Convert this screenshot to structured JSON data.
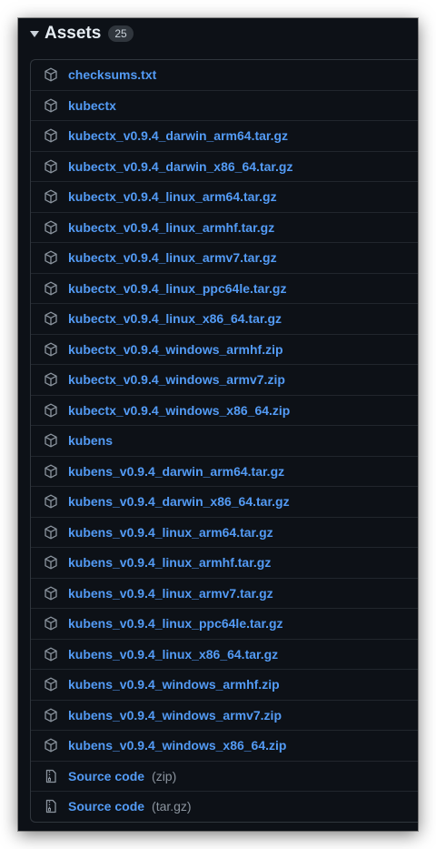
{
  "assets": {
    "title": "Assets",
    "count": "25",
    "files": [
      "checksums.txt",
      "kubectx",
      "kubectx_v0.9.4_darwin_arm64.tar.gz",
      "kubectx_v0.9.4_darwin_x86_64.tar.gz",
      "kubectx_v0.9.4_linux_arm64.tar.gz",
      "kubectx_v0.9.4_linux_armhf.tar.gz",
      "kubectx_v0.9.4_linux_armv7.tar.gz",
      "kubectx_v0.9.4_linux_ppc64le.tar.gz",
      "kubectx_v0.9.4_linux_x86_64.tar.gz",
      "kubectx_v0.9.4_windows_armhf.zip",
      "kubectx_v0.9.4_windows_armv7.zip",
      "kubectx_v0.9.4_windows_x86_64.zip",
      "kubens",
      "kubens_v0.9.4_darwin_arm64.tar.gz",
      "kubens_v0.9.4_darwin_x86_64.tar.gz",
      "kubens_v0.9.4_linux_arm64.tar.gz",
      "kubens_v0.9.4_linux_armhf.tar.gz",
      "kubens_v0.9.4_linux_armv7.tar.gz",
      "kubens_v0.9.4_linux_ppc64le.tar.gz",
      "kubens_v0.9.4_linux_x86_64.tar.gz",
      "kubens_v0.9.4_windows_armhf.zip",
      "kubens_v0.9.4_windows_armv7.zip",
      "kubens_v0.9.4_windows_x86_64.zip"
    ],
    "source": [
      {
        "label": "Source code",
        "format": "(zip)"
      },
      {
        "label": "Source code",
        "format": "(tar.gz)"
      }
    ]
  },
  "icons": {
    "file": "package-icon",
    "source": "file-zip-icon"
  },
  "colors": {
    "background": "#0d1117",
    "link": "#539bf5",
    "border": "#30363d",
    "muted": "#8b949e"
  }
}
